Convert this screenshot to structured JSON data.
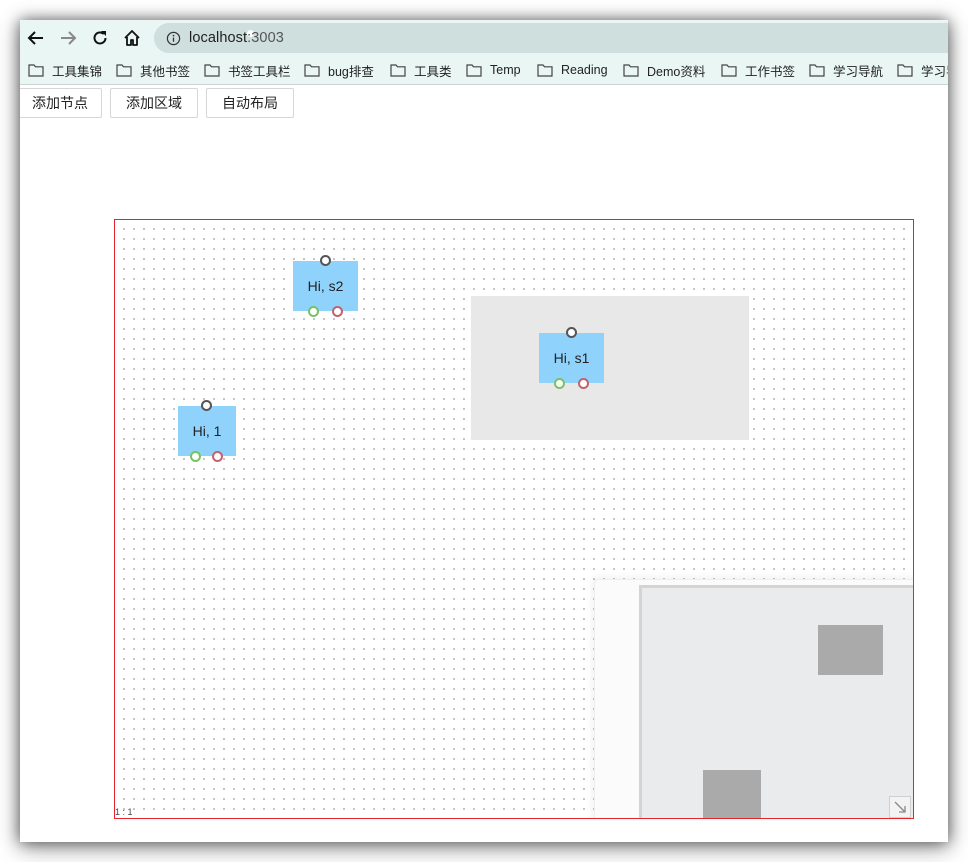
{
  "browser": {
    "url_host": "localhost",
    "url_port": ":3003",
    "bookmarks": [
      "工具集锦",
      "其他书签",
      "书签工具栏",
      "bug排查",
      "工具类",
      "Temp",
      "Reading",
      "Demo资料",
      "工作书签",
      "学习导航",
      "学习导"
    ]
  },
  "toolbar": {
    "add_node": "添加节点",
    "add_region": "添加区域",
    "auto_layout": "自动布局"
  },
  "canvas": {
    "scale_label": "1 : 1",
    "nodes": [
      {
        "label": "Hi, s2"
      },
      {
        "label": "Hi, s1"
      },
      {
        "label": "Hi, 1"
      }
    ],
    "colors": {
      "border": "#e2262c",
      "node": "#8fd3fc",
      "region": "#e8e8e8",
      "port_in": "#555555",
      "port_out_green": "#78c263",
      "port_out_red": "#c2626b"
    }
  }
}
